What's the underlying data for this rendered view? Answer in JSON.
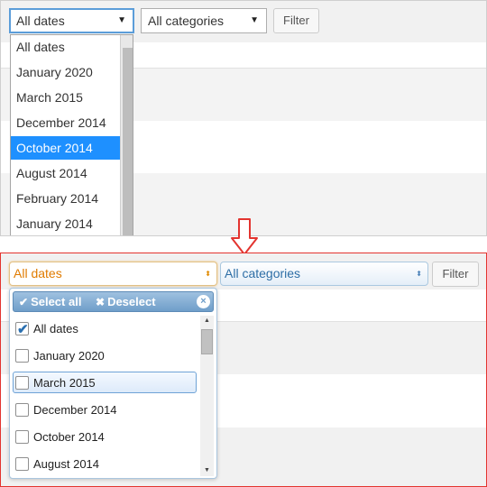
{
  "top": {
    "dates_select": {
      "value": "All dates",
      "arrow": "▼"
    },
    "categories_select": {
      "value": "All categories",
      "arrow": "▼"
    },
    "filter_button": "Filter",
    "native_dropdown": {
      "items": [
        {
          "label": "All dates",
          "selected": false
        },
        {
          "label": "January 2020",
          "selected": false
        },
        {
          "label": "March 2015",
          "selected": false
        },
        {
          "label": "December 2014",
          "selected": false
        },
        {
          "label": "October 2014",
          "selected": true
        },
        {
          "label": "August 2014",
          "selected": false
        },
        {
          "label": "February 2014",
          "selected": false
        },
        {
          "label": "January 2014",
          "selected": false
        }
      ]
    }
  },
  "arrow": {
    "icon": "down-arrow-icon",
    "color": "#e3342f"
  },
  "bottom": {
    "dates_select": {
      "value": "All dates",
      "caret": "⬍"
    },
    "categories_select": {
      "value": "All categories",
      "caret": "⬍"
    },
    "filter_button": "Filter",
    "multiselect": {
      "select_all_label": "Select all",
      "select_all_glyph": "✔",
      "deselect_label": "Deselect",
      "deselect_glyph": "✖",
      "close_glyph": "×",
      "items": [
        {
          "label": "All dates",
          "checked": true,
          "hover": false
        },
        {
          "label": "January 2020",
          "checked": false,
          "hover": false
        },
        {
          "label": "March 2015",
          "checked": false,
          "hover": true
        },
        {
          "label": "December 2014",
          "checked": false,
          "hover": false
        },
        {
          "label": "October 2014",
          "checked": false,
          "hover": false
        },
        {
          "label": "August 2014",
          "checked": false,
          "hover": false
        }
      ],
      "scroll_up": "▲",
      "scroll_down": "▼"
    }
  },
  "colors": {
    "highlight_blue": "#1e90ff",
    "accent_orange": "#e07b00",
    "link_blue": "#2e6ea6",
    "frame_red": "#e3342f"
  }
}
